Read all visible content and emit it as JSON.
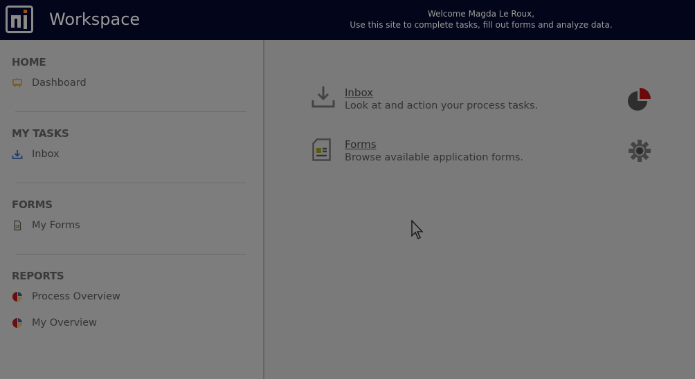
{
  "header": {
    "logo_text": "nj",
    "title": "Workspace",
    "welcome_line1": "Welcome Magda Le Roux,",
    "welcome_line2": "Use this site to complete tasks, fill out forms and analyze data."
  },
  "sidebar": {
    "sections": [
      {
        "title": "HOME",
        "items": [
          {
            "label": "Dashboard",
            "icon": "easel-icon"
          }
        ]
      },
      {
        "title": "MY TASKS",
        "items": [
          {
            "label": "Inbox",
            "icon": "download-icon"
          }
        ]
      },
      {
        "title": "FORMS",
        "items": [
          {
            "label": "My Forms",
            "icon": "form-icon"
          }
        ]
      },
      {
        "title": "REPORTS",
        "items": [
          {
            "label": "Process Overview",
            "icon": "pie-chart-icon"
          },
          {
            "label": "My Overview",
            "icon": "pie-chart-icon"
          }
        ]
      }
    ]
  },
  "main": {
    "cards": [
      {
        "title": "Inbox",
        "description": "Look at and action your process tasks.",
        "icon": "download-icon",
        "right_icon": "pie-chart-icon"
      },
      {
        "title": "Forms",
        "description": "Browse available application forms.",
        "icon": "form-icon",
        "right_icon": "gear-icon"
      }
    ]
  },
  "colors": {
    "header_bg": "#03051a",
    "accent_red": "#7a0a0a",
    "accent_blue": "#1f3a6b",
    "accent_orange": "#b8650a"
  }
}
